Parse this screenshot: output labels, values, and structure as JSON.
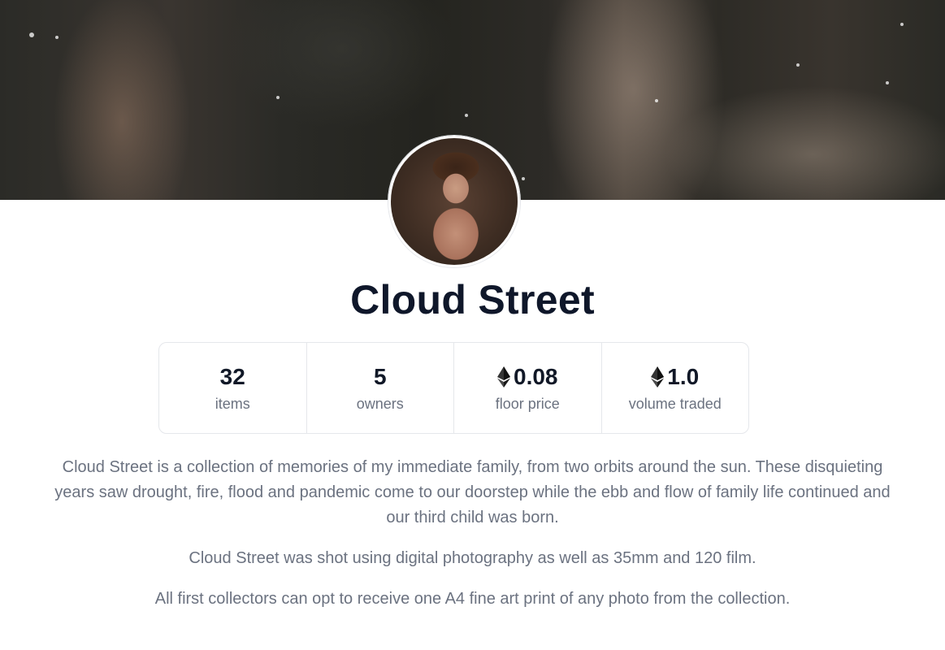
{
  "collection": {
    "name": "Cloud Street"
  },
  "stats": [
    {
      "value": "32",
      "label": "items",
      "currency_icon": null
    },
    {
      "value": "5",
      "label": "owners",
      "currency_icon": null
    },
    {
      "value": "0.08",
      "label": "floor price",
      "currency_icon": "ethereum-icon"
    },
    {
      "value": "1.0",
      "label": "volume traded",
      "currency_icon": "ethereum-icon"
    }
  ],
  "description": {
    "paragraph_1": "Cloud Street is a collection of memories of my immediate family, from two orbits around the sun. These disquieting years saw drought, fire, flood and pandemic come to our doorstep while the ebb and flow of family life continued and our third child was born.",
    "paragraph_2": "Cloud Street was shot using digital photography as well as 35mm and 120 film.",
    "paragraph_3": "All first collectors can opt to receive one A4 fine art print of any photo from the collection."
  },
  "colors": {
    "title": "#0f172a",
    "body_text": "#6b7280",
    "border": "#e5e7eb"
  }
}
